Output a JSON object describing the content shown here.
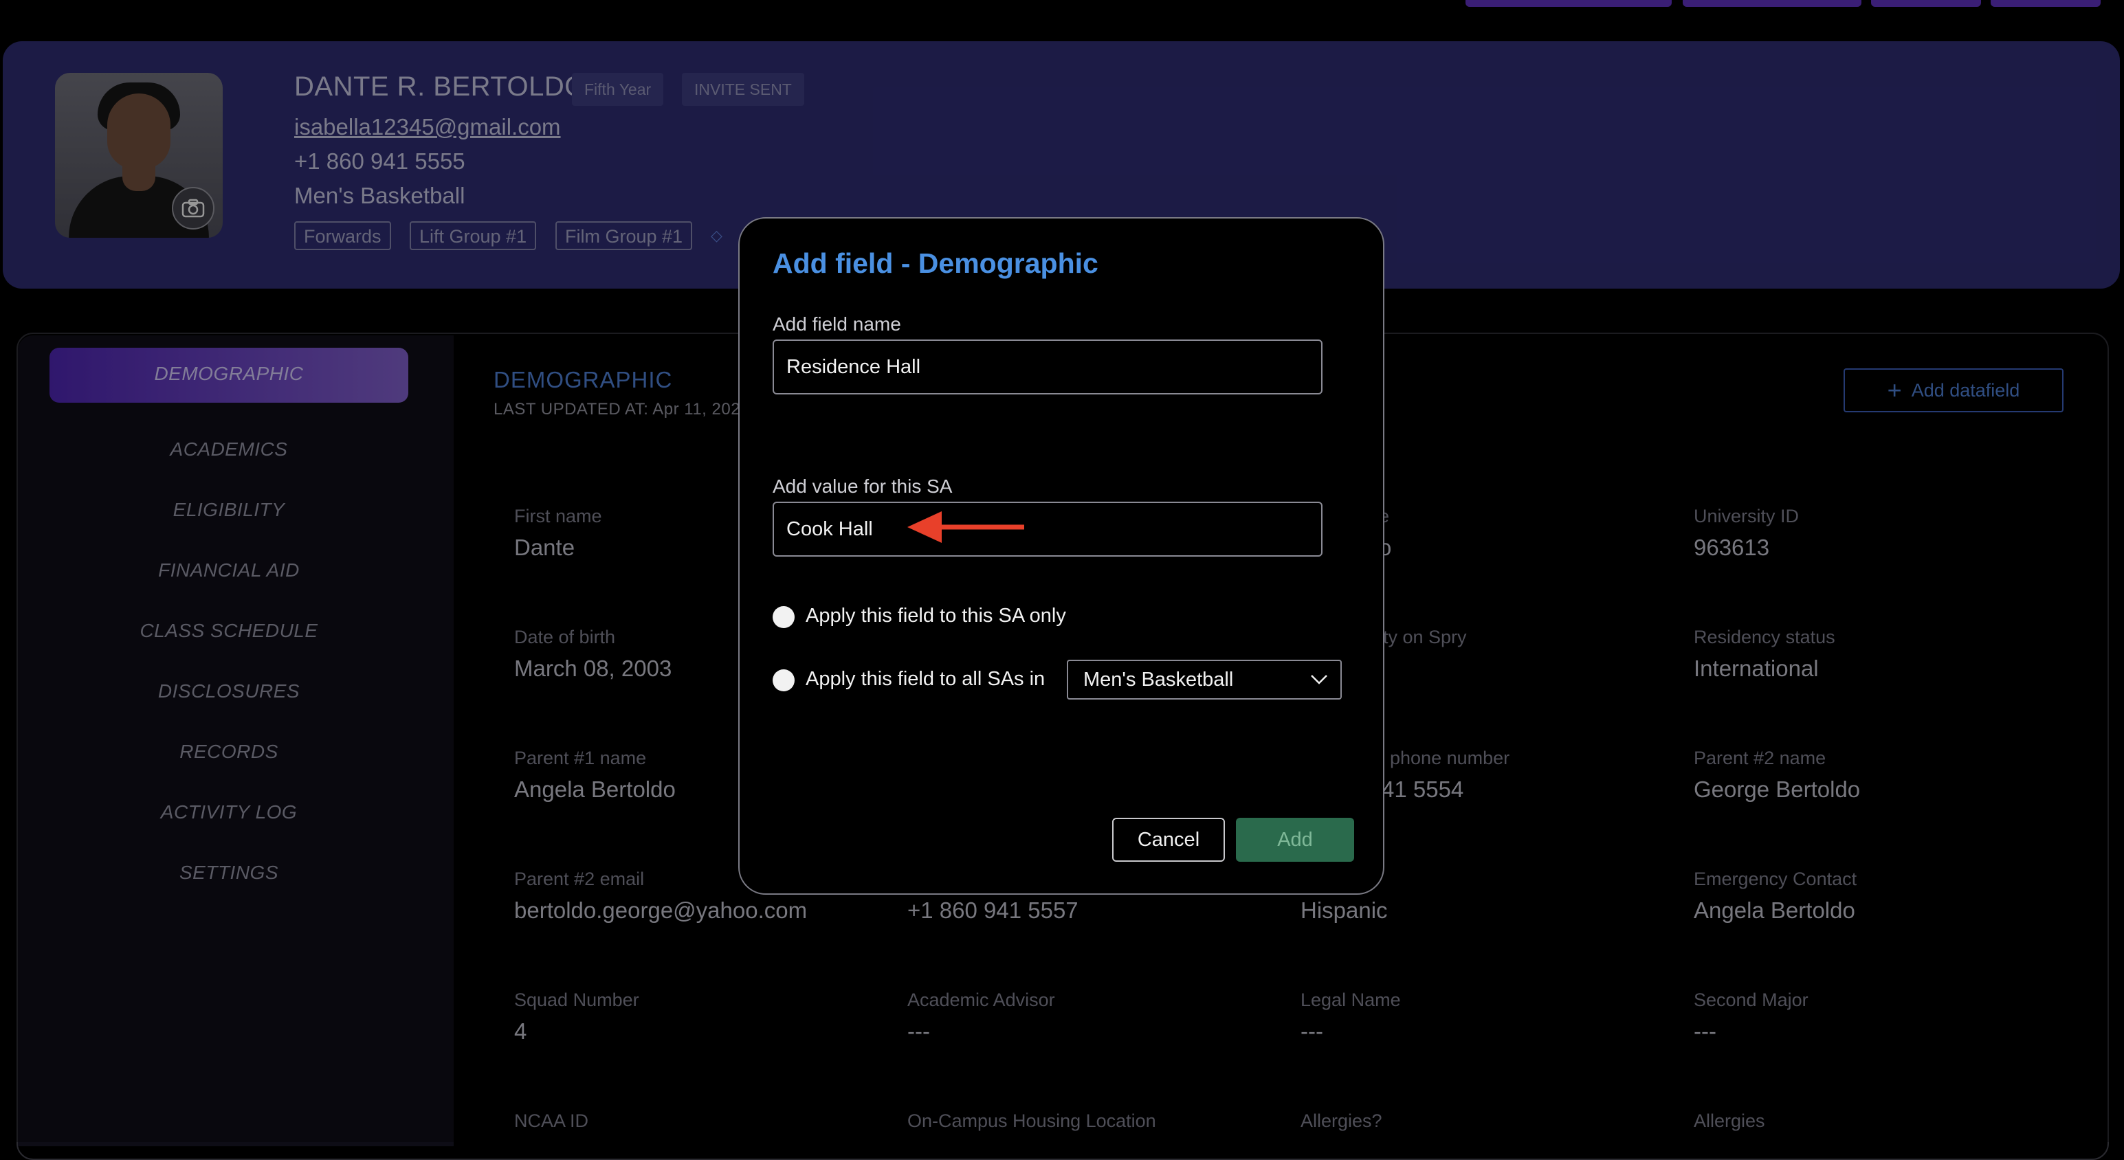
{
  "profile": {
    "name": "DANTE R. BERTOLDO",
    "badges": [
      "Fifth Year",
      "INVITE SENT"
    ],
    "email": "isabella12345@gmail.com",
    "phone": "+1 860 941 5555",
    "sport": "Men's Basketball",
    "tags": [
      "Forwards",
      "Lift Group #1",
      "Film Group #1"
    ]
  },
  "sidebar": {
    "items": [
      {
        "label": "DEMOGRAPHIC"
      },
      {
        "label": "ACADEMICS"
      },
      {
        "label": "ELIGIBILITY"
      },
      {
        "label": "FINANCIAL AID"
      },
      {
        "label": "CLASS SCHEDULE"
      },
      {
        "label": "DISCLOSURES"
      },
      {
        "label": "RECORDS"
      },
      {
        "label": "ACTIVITY LOG"
      },
      {
        "label": "SETTINGS"
      }
    ]
  },
  "section": {
    "title": "DEMOGRAPHIC",
    "updated": "LAST UPDATED AT: Apr 11, 202",
    "add_datafield": "Add datafield"
  },
  "fields": [
    {
      "label": "First name",
      "value": "Dante"
    },
    {
      "label": "e",
      "value": "o"
    },
    {
      "label": "University ID",
      "value": "963613"
    },
    {
      "label": "Date of birth",
      "value": "March 08, 2003"
    },
    {
      "label": "ity on Spry",
      "value": ""
    },
    {
      "label": "Residency status",
      "value": "International"
    },
    {
      "label": "Parent #1 name",
      "value": "Angela Bertoldo"
    },
    {
      "label": "phone number",
      "value": "41 5554"
    },
    {
      "label": "Parent #2 name",
      "value": "George Bertoldo"
    },
    {
      "label": "Parent #2 email",
      "value": "bertoldo.george@yahoo.com"
    },
    {
      "label": "",
      "value": "+1 860 941 5557"
    },
    {
      "label": "",
      "value": "Hispanic"
    },
    {
      "label": "Emergency Contact",
      "value": "Angela Bertoldo"
    },
    {
      "label": "Squad Number",
      "value": "4"
    },
    {
      "label": "Academic Advisor",
      "value": "---"
    },
    {
      "label": "Legal Name",
      "value": "---"
    },
    {
      "label": "Second Major",
      "value": "---"
    },
    {
      "label": "NCAA ID",
      "value": ""
    },
    {
      "label": "On-Campus Housing Location",
      "value": ""
    },
    {
      "label": "Allergies?",
      "value": ""
    },
    {
      "label": "Allergies",
      "value": ""
    }
  ],
  "modal": {
    "title": "Add field - Demographic",
    "field_name_label": "Add field name",
    "field_name_value": "Residence Hall",
    "value_label": "Add value for this SA",
    "value_value": "Cook Hall",
    "radio_only": "Apply this field to this SA only",
    "radio_all": "Apply this field to all SAs in",
    "select_value": "Men's Basketball",
    "cancel": "Cancel",
    "add": "Add"
  },
  "colors": {
    "accent": "#4a90e2",
    "add_button": "#2a6a4c",
    "profile_bg": "#2b2a6b",
    "annotation_arrow": "#e8402a"
  }
}
